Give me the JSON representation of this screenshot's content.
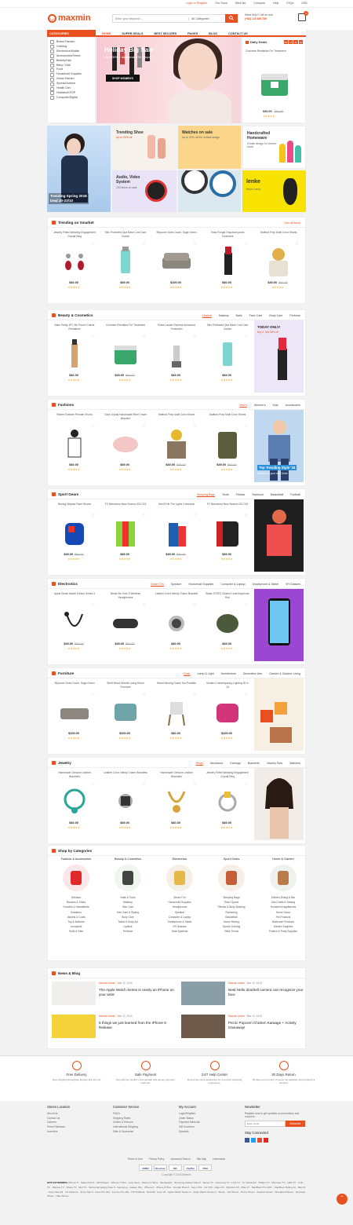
{
  "topbar": {
    "links": [
      "Login or Register",
      "Our Store",
      "Wish list",
      "Compare",
      "Help",
      "FAQs",
      "USD"
    ]
  },
  "header": {
    "logo": "maxmin",
    "search": {
      "placeholder": "Enter your keyword ...",
      "category": "All Categories"
    },
    "phone": {
      "label": "Need help? Call us now",
      "number": "(+84) 123 456 789"
    },
    "cart_count": "0"
  },
  "nav": {
    "categories_label": "CATEGORIES",
    "items": [
      "HOME",
      "SUPER DEALS",
      "BEST SELLERS",
      "PAGES",
      "BLOG",
      "CONTACT US"
    ]
  },
  "categories": [
    "Brand Fashion",
    "Clothing",
    "Electronics/Mobile",
    "Accessories/Shoes",
    "Beauty/Hair",
    "Baby / Kids",
    "Food",
    "Household Supplies",
    "Home Kitchen",
    "Sports/Outdoor",
    "Health Diet",
    "Hobbies/KPOP",
    "Computer/Digital"
  ],
  "hero": {
    "title": "Holiday Big Sale",
    "subtitle": "Up to 50% + additional 20% coupon",
    "button": "SHOP WOMEN'S"
  },
  "daily_deals": {
    "title": "Daily Deals",
    "timer": [
      "00",
      "14",
      "23",
      "20"
    ],
    "product": "Concrete Revitalize For Treatment",
    "price": "$40.00",
    "old": "$50.00",
    "stars": "★★★★★"
  },
  "banners": {
    "trending": {
      "title": "Trending Shoe",
      "sub": "Up to 50% off"
    },
    "watches": {
      "title": "Watches on sale",
      "sub": "Up to 30% off the hottest design"
    },
    "homeware": {
      "title": "Handcrafted Homeware",
      "sub": "Create design for forever loved"
    },
    "left": {
      "title": "Trending Spring 2018",
      "sub": "Deal 20-23/10"
    },
    "audio": {
      "title": "Audio, Video System",
      "sub": "230 items on sale"
    },
    "lenke": {
      "title": "lenke",
      "sub": "Wood Lamp"
    }
  },
  "sections": [
    {
      "title": "Trending on Smarket",
      "more": "See all items",
      "products": [
        {
          "name": "Jewelry Fitted Wedding Engagement Crystal Ring",
          "price": "$40.00",
          "old": ""
        },
        {
          "name": "Skin Protected Que Base Cool Care Cuticle",
          "price": "$49.00",
          "old": ""
        },
        {
          "name": "Slipcover Sofa Couch, Sage Green",
          "price": "$100.00",
          "old": ""
        },
        {
          "name": "Tests Fungal Onychomycosis Treatment",
          "price": "$40.00",
          "old": ""
        },
        {
          "name": "Stafford Prep Multi Color Shorts",
          "price": "$40.00",
          "old": "$50.00"
        }
      ]
    },
    {
      "title": "Beauty & Cosmetics",
      "tabs": [
        "Lipstick",
        "Makeup",
        "Nails",
        "Face Care",
        "Body Care",
        "Perfume"
      ],
      "side": {
        "title": "TODAY ONLY!",
        "sub": "Buy 2, Get 30% off"
      },
      "products": [
        {
          "name": "Base Pretty 1PC Brr Pouch Cuticle Revitalizer",
          "price": "$40.00",
          "old": ""
        },
        {
          "name": "Concrete Revitalize For Treatment",
          "price": "$40.00",
          "old": "$50.00"
        },
        {
          "name": "Estee Lauder Express Advanced Protection",
          "price": "$49.00",
          "old": ""
        },
        {
          "name": "Skin Protected Que Base Cool Care Cuticle",
          "price": "$49.00",
          "old": ""
        }
      ]
    },
    {
      "title": "Fashions",
      "tabs": [
        "Men's",
        "Women's",
        "Kids",
        "Accessories"
      ],
      "side": {
        "title": "Top Trending Style '18",
        "sub": "Get $30 on your next Order"
      },
      "products": [
        {
          "name": "Robert Graham Premier Shorts",
          "price": "$40.00",
          "old": ""
        },
        {
          "name": "Gold Crystal Handmade Effort Travel Bracelet",
          "price": "$49.00",
          "old": ""
        },
        {
          "name": "Stafford Prep Multi Color Shorts",
          "price": "$40.00",
          "old": "$50.00"
        },
        {
          "name": "Stafford Prep Multi Color Shorts",
          "price": "$49.00",
          "old": "$60.00"
        }
      ]
    },
    {
      "title": "Sport Gears",
      "tabs": [
        "Sleeping Bags",
        "Tents",
        "Fitness",
        "Swimsuit",
        "Basketball",
        "Football"
      ],
      "products": [
        {
          "name": "Racing Dirtpaw Race Gloves",
          "price": "$40.00",
          "old": "$50.00"
        },
        {
          "name": "FC Barcelona New Season 2017/18",
          "price": "$49.00",
          "old": ""
        },
        {
          "name": "Men'S Hit The Lights Crewneck",
          "price": "$40.00",
          "old": "$50.00"
        },
        {
          "name": "FC Barcelona New Season 2017/18",
          "price": "$49.00",
          "old": ""
        }
      ]
    },
    {
      "title": "Electronics",
      "tabs": [
        "Smart TVs",
        "Speaker",
        "Household Supplies",
        "Computer & Laptop",
        "Smartphone & Tablet",
        "VR Glasses"
      ],
      "products": [
        {
          "name": "Apple Smart Watch Edition Series 3",
          "price": "$40.00",
          "old": "$50.00"
        },
        {
          "name": "Beats Sm Solo 3 Wireless Headphones",
          "price": "$49.00",
          "old": "$50.00"
        },
        {
          "name": "Leather Color Infinity Charm Bracelet",
          "price": "$40.00",
          "old": ""
        },
        {
          "name": "Beats STEEZ Sealed Coral Earphone Red",
          "price": "$49.00",
          "old": ""
        }
      ]
    },
    {
      "title": "Furniture",
      "tabs": [
        "Chair",
        "Lamp & Light",
        "Architecture",
        "Decorative Arts",
        "Garden & Outdoor Living"
      ],
      "products": [
        {
          "name": "Slipcover Sofa Couch, Sage Green",
          "price": "$100.00",
          "old": ""
        },
        {
          "name": "Shelf Wood Dinette Living Room Furniture",
          "price": "$100.00",
          "old": ""
        },
        {
          "name": "Stand Serving Snack Tea Portable",
          "price": "$40.00",
          "old": ""
        },
        {
          "name": "Modern Contemporary Lighting 30 in 15",
          "price": "$100.00",
          "old": ""
        }
      ]
    },
    {
      "title": "Jewelry",
      "tabs": [
        "Rings",
        "Necklaces",
        "Earrings",
        "Bracelets",
        "Jewelry Sets",
        "Watches"
      ],
      "products": [
        {
          "name": "Handmade Genuine Leather Bracelets",
          "price": "$40.00",
          "old": ""
        },
        {
          "name": "Leather Color Infinity Charm Bracelets",
          "price": "$49.00",
          "old": ""
        },
        {
          "name": "Handmade Genuine Leather Bracelets",
          "price": "$40.00",
          "old": ""
        },
        {
          "name": "Jewelry Fitted Wedding Engagement Crystal Ring",
          "price": "$49.00",
          "old": ""
        }
      ]
    }
  ],
  "shop_categories": {
    "title": "Shop by Categories",
    "cols": [
      {
        "name": "Fashion & Accessories",
        "items": [
          "Dresses",
          "Blouses & Shirts",
          "Hoodies & Sweatshirts",
          "Sweaters",
          "Jackets & Coats",
          "Top & Bottoms",
          "Jumpsuits",
          "Suits & Sets"
        ]
      },
      {
        "name": "Beauty & Cosmetics",
        "items": [
          "Nails & Tools",
          "Makeup",
          "Skin Care",
          "Hair Care & Styling",
          "Body Care",
          "Tattoo & Body Art",
          "Lipstick",
          "Perfume"
        ]
      },
      {
        "name": "Electronics",
        "items": [
          "Smart TVs",
          "Household Supplies",
          "Headphones",
          "Speaker",
          "Computer & Laptop",
          "Smartphone & Tablet",
          "VR Glasses",
          "Data Systems"
        ]
      },
      {
        "name": "Sport Gears",
        "items": [
          "Sleeping Bags",
          "Team Sports",
          "Fitness & Body Building",
          "Swimming",
          "Basketball",
          "Horse Racing",
          "Sports Clothing",
          "Table Tennis"
        ]
      },
      {
        "name": "Home & Garden",
        "items": [
          "Kitchen,Dining & Bar",
          "Arts,Crafts & Sewing",
          "Household appliances",
          "Home Decor",
          "Pet Products",
          "Bathroom Products",
          "Garden Supplies",
          "Festive & Party Supplies"
        ]
      }
    ]
  },
  "news": {
    "title": "News & Blog",
    "articles": [
      {
        "author": "Maxmin Admin",
        "date": "Mar 12, 2018",
        "title": "The Apple Watch Series is nearly an iPhone on your wrist"
      },
      {
        "author": "Maxmin Admin",
        "date": "Mar 12, 2018",
        "title": "Nest Hello doorbell camera can recognize your face"
      },
      {
        "author": "Maxmin Admin",
        "date": "Mar 12, 2018",
        "title": "5 things we just learned from the iPhone 8 Release"
      },
      {
        "author": "Maxmin Admin",
        "date": "Mar 12, 2018",
        "title": "Picnic Popcorn Chicken Karaage + Activity Giveaway!"
      }
    ]
  },
  "services": [
    {
      "title": "Free Delivery",
      "text": "Free shipping throughout Europe and the US"
    },
    {
      "title": "Safe Payment",
      "text": "Pay with the world's most popular and secure payment methods."
    },
    {
      "title": "24/7 Help Center",
      "text": "Round-the-clock assistance for a smooth shopping experience."
    },
    {
      "title": "30 Days Return",
      "text": "30 days return policy if you're not satisfied with products & services"
    }
  ],
  "footer": {
    "store": {
      "title": "Stores Location",
      "links": [
        "About Us",
        "Contact Us",
        "Careers",
        "Press Releases",
        "Investors"
      ]
    },
    "service": {
      "title": "Customer Service",
      "links": [
        "FAQ's",
        "Shipping Rates",
        "Orders & Returns",
        "International Shipping",
        "Safe & Guarantee"
      ]
    },
    "account": {
      "title": "My Account",
      "links": [
        "Login/Register",
        "Order Status",
        "Payment Methods",
        "Gift Vouchers",
        "Specials"
      ]
    },
    "newsletter": {
      "title": "Newsletter",
      "text": "Register now to get updates on promotions and coupons.",
      "placeholder": "Enter email",
      "button": "Subscribe",
      "connected": "Stay Connected"
    },
    "links": [
      "Terms of Use",
      "Privacy Policy",
      "Advanced Search",
      "Site Map",
      "Information"
    ],
    "payments": [
      "AMEX",
      "Discover",
      "MC",
      "PayPal",
      "VISA"
    ],
    "copyright": "Copyright © 2018 Maxmin",
    "keywords_label": "HOT KEYWORDS:",
    "keywords": "iPhone 8 · Tablet iPad 3 · MP3 Player · iPhone 7 Plus · Lady Sexy · Women's Shoe · Backpacks · Samsung Galaxy Note 8 · Sanyo TV · Samsung TV · LG4 TV · TV Television · Philips TV · Minmaxe TV · LED TV · LCD TV · Plasma TV · Sharp TV · Dell TV · Samsung Galaxy Note 8 · Samsung · Galaxy S8+ · iPhone 8 · iPhone 8 Plus · Google Pixel 2 · Sony XZ1 · LG V30 · Oppo A3 · Optimus G3 · iMac 27 · MacBook Pro 2017 · MacBook Retina 12 · Mac M · Sony Vaio Z3 · LG Optimus · Sony Vaio Z · Asus Pro 301 · Lenovo Pro 301 · HP ProBook · Dell M2 · Acer V8 · Apple Watch Series 3 · Apple Watch Series 2 · Shoes · Girl Shoes · Puma Shoes · Reebok Shoes · Woodland Shoes · Red tape Shoes · Nike Shoes"
  }
}
